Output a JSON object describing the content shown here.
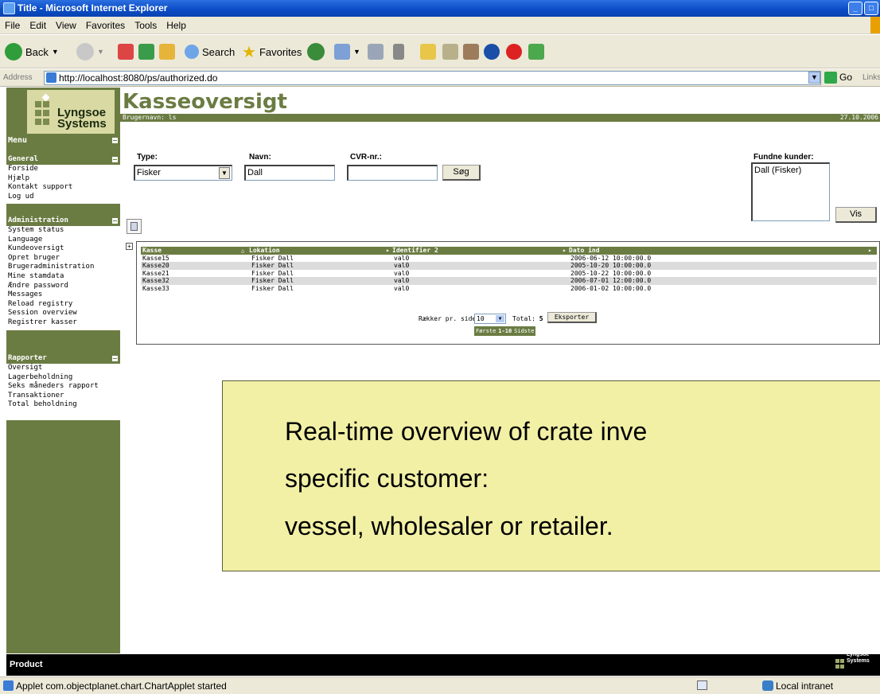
{
  "window": {
    "title": "Title - Microsoft Internet Explorer"
  },
  "menubar": {
    "items": [
      "File",
      "Edit",
      "View",
      "Favorites",
      "Tools",
      "Help"
    ]
  },
  "toolbar": {
    "back": "Back",
    "search": "Search",
    "favorites": "Favorites"
  },
  "address": {
    "label": "Address",
    "url": "http://localhost:8080/ps/authorized.do",
    "go": "Go",
    "links": "Links"
  },
  "app": {
    "logo": {
      "line1": "Lyngsoe",
      "line2": "Systems"
    },
    "title": "Kasseoversigt",
    "username": "Brugernavn: ls",
    "date": "27.10.2006",
    "menu_label": "Menu",
    "sections": [
      {
        "title": "General",
        "items": [
          "Forside",
          "Hjælp",
          "Kontakt support",
          "Log ud"
        ]
      },
      {
        "title": "Administration",
        "items": [
          "System status",
          "Language",
          "Kundeoversigt",
          "Opret bruger",
          "Brugeradministration",
          "Mine stamdata",
          "Ændre password",
          "Messages",
          "Reload registry",
          "Session overview",
          "Registrer kasser"
        ]
      },
      {
        "title": "Rapporter",
        "items": [
          "Oversigt",
          "Lagerbeholdning",
          "Seks måneders rapport",
          "Transaktioner",
          "Total beholdning"
        ]
      }
    ],
    "form": {
      "type_label": "Type:",
      "type_value": "Fisker",
      "navn_label": "Navn:",
      "navn_value": "Dall",
      "cvr_label": "CVR-nr.:",
      "cvr_value": "",
      "search_button": "Søg",
      "found_label": "Fundne kunder:",
      "found_items": [
        "Dall (Fisker)"
      ],
      "show_button": "Vis"
    },
    "table": {
      "columns": [
        "Kasse",
        "Lokation",
        "Identifier 2",
        "Dato ind"
      ],
      "rows": [
        [
          "Kasse15",
          "Fisker Dall",
          "val0",
          "2006-06-12 10:00:00.0"
        ],
        [
          "Kasse20",
          "Fisker Dall",
          "val0",
          "2005-10-20 10:00:00.0"
        ],
        [
          "Kasse21",
          "Fisker Dall",
          "val0",
          "2005-10-22 10:00:00.0"
        ],
        [
          "Kasse32",
          "Fisker Dall",
          "val0",
          "2006-07-01 12:00:00.0"
        ],
        [
          "Kasse33",
          "Fisker Dall",
          "val0",
          "2006-01-02 10:00:00.0"
        ]
      ],
      "rows_per_page_label": "Rækker pr. side:",
      "rows_per_page": "10",
      "total_label": "Total:",
      "total": "5",
      "export_button": "Eksporter",
      "pager": {
        "first": "Første",
        "range": "1-10",
        "last": "Sidste"
      }
    },
    "footer": {
      "label": "Product"
    }
  },
  "overlay": {
    "line1": "Real-time overview of crate inve",
    "line2": "specific customer:",
    "line3": "vessel, wholesaler or retailer."
  },
  "status": {
    "text": "Applet com.objectplanet.chart.ChartApplet started",
    "zone": "Local intranet"
  },
  "colors": {
    "theme": "#6b7c43",
    "overlay": "#f2f0a5",
    "logo_bg": "#d9d9a3"
  }
}
